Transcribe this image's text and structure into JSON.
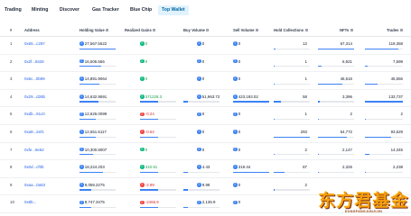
{
  "nav": {
    "tabs": [
      {
        "label": "Trading"
      },
      {
        "label": "Minting"
      },
      {
        "label": "Discover"
      },
      {
        "label": "Gas Tracker"
      },
      {
        "label": "Blue Chip"
      },
      {
        "label": "Top Wallet"
      }
    ],
    "active_tab": "Top Wallet"
  },
  "table": {
    "columns": [
      "#",
      "Address",
      "Holding Value",
      "Realized Gains",
      "Buy Volume",
      "Sell Volume",
      "Hold Collections",
      "NFTs",
      "Trades"
    ],
    "rows": [
      {
        "rank": "1",
        "address": "0x65...c297",
        "holding": "27,567.5522",
        "holding_pct": 1.0,
        "gains": "0",
        "gains_sign": "pos",
        "buy": "0",
        "sell": "0",
        "collections": "12",
        "nfts": "67,314",
        "trades": "119,358",
        "coll_pct": 0.04,
        "nfts_pct": 1.0,
        "trades_pct": 0.89
      },
      {
        "rank": "2",
        "address": "0x2f...8426",
        "holding": "16,506.556",
        "holding_pct": 0.6,
        "gains": "0",
        "gains_sign": "pos",
        "buy": "0",
        "sell": "0",
        "collections": "1",
        "nfts": "6,921",
        "trades": "7,599",
        "coll_pct": 0.0,
        "nfts_pct": 0.1,
        "trades_pct": 0.06
      },
      {
        "rank": "3",
        "address": "0x6c...0b99",
        "holding": "14,891.9064",
        "holding_pct": 0.54,
        "gains": "0",
        "gains_sign": "pos",
        "buy": "0",
        "sell": "0",
        "collections": "1",
        "nfts": "45,616",
        "trades": "45,556",
        "coll_pct": 0.0,
        "nfts_pct": 0.68,
        "trades_pct": 0.34
      },
      {
        "rank": "4",
        "address": "0x29...d28b",
        "holding": "14,632.9591",
        "holding_pct": 0.53,
        "gains": "371228.3",
        "gains_sign": "pos",
        "buy": "51,963.72",
        "sell": "423,193.02",
        "collections": "58",
        "nfts": "3,396",
        "trades": "133,737",
        "coll_pct": 0.2,
        "nfts_pct": 0.05,
        "trades_pct": 1.0
      },
      {
        "rank": "5",
        "address": "0xdb...91c0",
        "holding": "12,626.0099",
        "holding_pct": 0.46,
        "gains": "-0.24",
        "gains_sign": "neg",
        "buy": "0",
        "sell": "0",
        "collections": "1",
        "nfts": "2",
        "trades": "2",
        "coll_pct": 0.0,
        "nfts_pct": 0.0,
        "trades_pct": 0.0
      },
      {
        "rank": "6",
        "address": "0xa8...2ef1",
        "holding": "12,651.5117",
        "holding_pct": 0.46,
        "gains": "-0.62",
        "gains_sign": "neg",
        "buy": "0",
        "sell": "0",
        "collections": "293",
        "nfts": "54,772",
        "trades": "93,529",
        "coll_pct": 1.0,
        "nfts_pct": 0.81,
        "trades_pct": 0.7
      },
      {
        "rank": "7",
        "address": "0xfe...6e62",
        "holding": "10,300.8007",
        "holding_pct": 0.37,
        "gains": "0",
        "gains_sign": "pos",
        "buy": "0",
        "sell": "0",
        "collections": "2",
        "nfts": "2,147",
        "trades": "14,345",
        "coll_pct": 0.01,
        "nfts_pct": 0.03,
        "trades_pct": 0.11
      },
      {
        "rank": "8",
        "address": "0x0d...cf0b",
        "holding": "18,224.203",
        "holding_pct": 0.66,
        "gains": "310.91",
        "gains_sign": "pos",
        "buy": "4.43",
        "sell": "319.44",
        "collections": "87",
        "nfts": "2,326",
        "trades": "2,238",
        "coll_pct": 0.3,
        "nfts_pct": 0.03,
        "trades_pct": 0.02
      },
      {
        "rank": "9",
        "address": "0xaa...0a53",
        "holding": "9,059.2275",
        "holding_pct": 0.33,
        "gains": "-2.99",
        "gains_sign": "neg",
        "buy": "9.99",
        "sell": "0",
        "collections": "2",
        "nfts": "",
        "trades": "",
        "coll_pct": 0.01,
        "nfts_pct": 0.0,
        "trades_pct": 0.0
      },
      {
        "rank": "10",
        "address": "0x8b...",
        "holding": "8,747.3475",
        "holding_pct": 0.32,
        "gains": "-2466.9",
        "gains_sign": "neg",
        "buy": "2,136.9",
        "sell": "0",
        "collections": "",
        "nfts": "",
        "trades": "",
        "coll_pct": 0.0,
        "nfts_pct": 0.0,
        "trades_pct": 0.0
      }
    ]
  },
  "watermark": {
    "text": "东方君基金",
    "subtext": "DONGFANGJUNJIJIN"
  },
  "colors": {
    "accent": "#3b82f6",
    "positive": "#16a34a",
    "negative": "#dc2626",
    "active_tab_bg": "#e0f2fe"
  }
}
